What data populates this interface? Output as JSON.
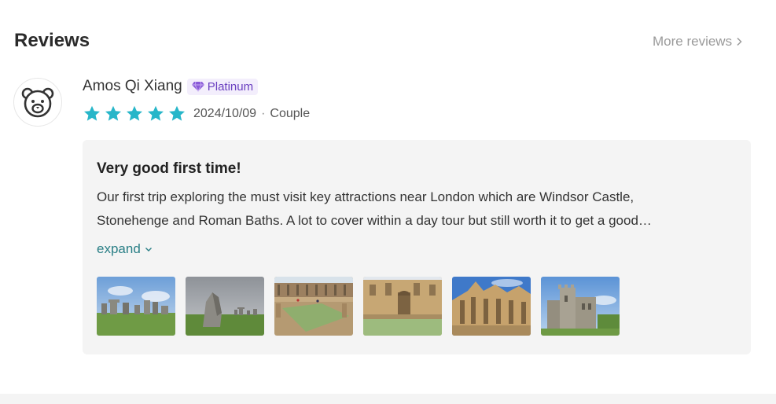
{
  "section": {
    "title": "Reviews",
    "more_label": "More reviews"
  },
  "review": {
    "user_name": "Amos Qi Xiang",
    "badge_label": "Platinum",
    "rating": 5,
    "rating_max": 5,
    "date": "2024/10/09",
    "separator": "·",
    "traveler_type": "Couple",
    "title": "Very good first time!",
    "text_lines": [
      "Our first trip exploring the must visit key attractions near London which are Windsor Castle,",
      "Stonehenge and Roman Baths. A lot to cover within a day tour but still worth it to get a good…"
    ],
    "expand_label": "expand",
    "photos": [
      {
        "subject": "stonehenge-circle"
      },
      {
        "subject": "stonehenge-stone"
      },
      {
        "subject": "roman-baths-terrace"
      },
      {
        "subject": "roman-baths-pool"
      },
      {
        "subject": "gothic-chapel"
      },
      {
        "subject": "windsor-castle"
      }
    ]
  },
  "colors": {
    "star": "#27b6c9",
    "link": "#2a7f86",
    "badge_text": "#6a3fc0",
    "badge_bg": "#f3eefc",
    "card_bg": "#f4f4f4"
  },
  "icons": {
    "avatar": "bear-face-icon",
    "badge": "diamond-icon",
    "star": "star-icon",
    "more": "chevron-right-icon",
    "expand": "chevron-down-icon"
  }
}
